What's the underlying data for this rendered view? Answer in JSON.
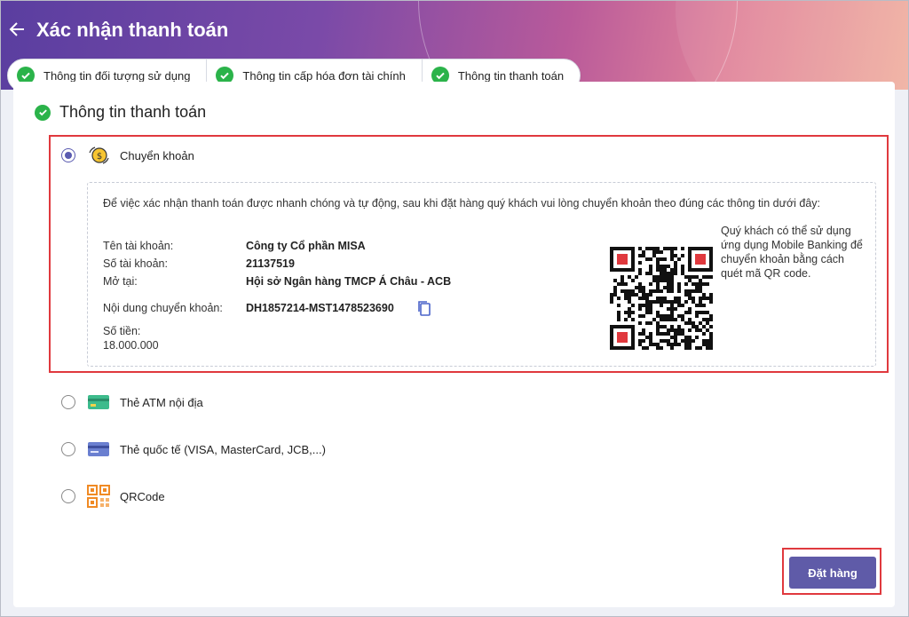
{
  "header": {
    "title": "Xác nhận thanh toán"
  },
  "steps": [
    {
      "label": "Thông tin đối tượng sử dụng"
    },
    {
      "label": "Thông tin cấp hóa đơn tài chính"
    },
    {
      "label": "Thông tin thanh toán"
    }
  ],
  "section": {
    "title": "Thông tin thanh toán"
  },
  "payment_options": [
    {
      "label": "Chuyển khoản",
      "selected": true,
      "icon": "money-transfer-icon"
    },
    {
      "label": "Thẻ ATM nội địa",
      "selected": false,
      "icon": "atm-card-icon"
    },
    {
      "label": "Thẻ quốc tế (VISA, MasterCard, JCB,...)",
      "selected": false,
      "icon": "credit-card-icon"
    },
    {
      "label": "QRCode",
      "selected": false,
      "icon": "qrcode-icon"
    }
  ],
  "transfer": {
    "intro": "Để việc xác nhận thanh toán được nhanh chóng và tự động, sau khi đặt hàng quý khách vui lòng chuyển khoản theo đúng các thông tin dưới đây:",
    "account_name_label": "Tên tài khoản:",
    "account_name": "Công ty Cổ phần MISA",
    "account_number_label": "Số tài khoản:",
    "account_number": "21137519",
    "bank_label": "Mở tại:",
    "bank": "Hội sở Ngân hàng TMCP Á Châu - ACB",
    "content_label": "Nội dung chuyển khoản:",
    "content": "DH1857214-MST1478523690",
    "amount_label": "Số tiền:",
    "amount": "18.000.000",
    "qr_note": "Quý khách có thể sử dụng ứng dụng Mobile Banking để chuyển khoản bằng cách quét mã QR code."
  },
  "actions": {
    "order_label": "Đặt hàng"
  },
  "colors": {
    "accent": "#5f5ba8",
    "success": "#2bb34a",
    "highlight": "#e0393e"
  }
}
